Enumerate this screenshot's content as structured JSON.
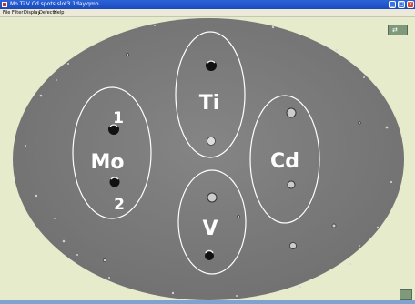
{
  "window": {
    "title": "Mo Ti V Cd spots slot3 1day.qmo",
    "minimize_icon": "minimize-icon",
    "maximize_icon": "maximize-icon",
    "close_icon": "close-icon"
  },
  "menu": {
    "items": [
      "File",
      "Filter",
      "Display",
      "Defects",
      "Help"
    ]
  },
  "image": {
    "spot_labels": {
      "ti": "Ti",
      "mo": "Mo",
      "cd": "Cd",
      "v": "V"
    },
    "spot_numbers": {
      "one": "1",
      "two": "2"
    }
  },
  "colors": {
    "titlebar": "#2c63d8",
    "background": "#e6ebcc",
    "plate": "#7d7d7d",
    "outline": "#ffffff"
  }
}
